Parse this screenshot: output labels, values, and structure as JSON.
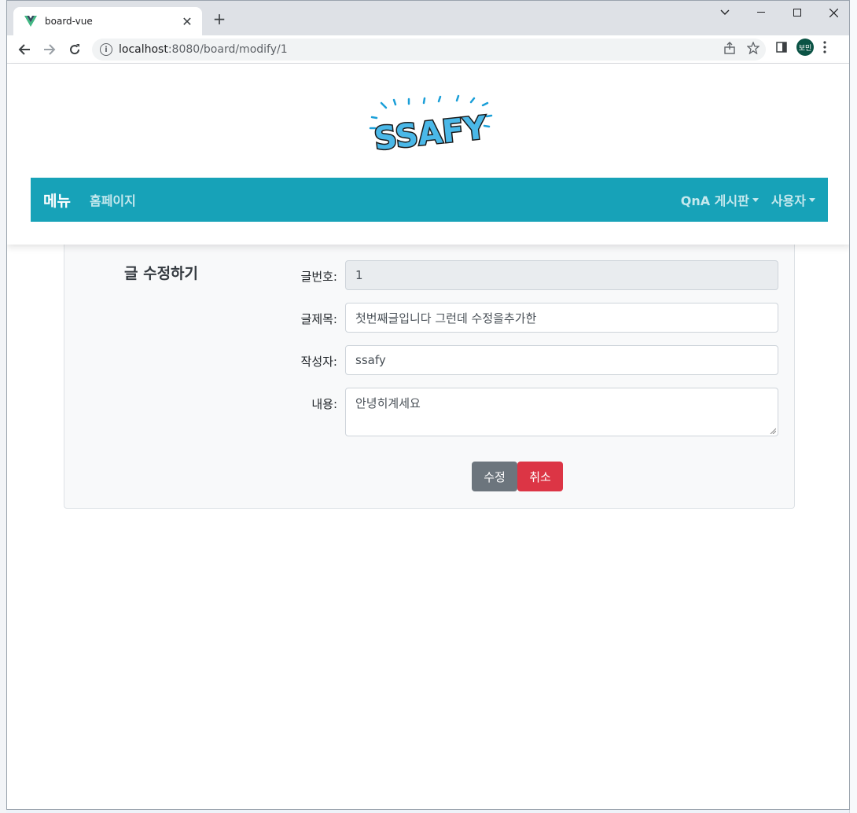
{
  "browser": {
    "tab_title": "board-vue",
    "url_host": "localhost",
    "url_path": ":8080/board/modify/1",
    "profile_initials": "보민"
  },
  "site": {
    "logo_text": "SSAFY",
    "navbar": {
      "brand": "메뉴",
      "home_link": "홈페이지",
      "qna_dropdown": "QnA 게시판",
      "user_dropdown": "사용자"
    },
    "colors": {
      "navbar": "#17a2b8",
      "modify_button": "#6c757d",
      "cancel_button": "#dc3545"
    }
  },
  "form": {
    "title": "글 수정하기",
    "no_label": "글번호:",
    "no_value": "1",
    "subject_label": "글제목:",
    "subject_value": "첫번째글입니다 그런데 수정을추가한",
    "writer_label": "작성자:",
    "writer_value": "ssafy",
    "content_label": "내용:",
    "content_value": "안녕히계세요",
    "modify_button": "수정",
    "cancel_button": "취소"
  }
}
